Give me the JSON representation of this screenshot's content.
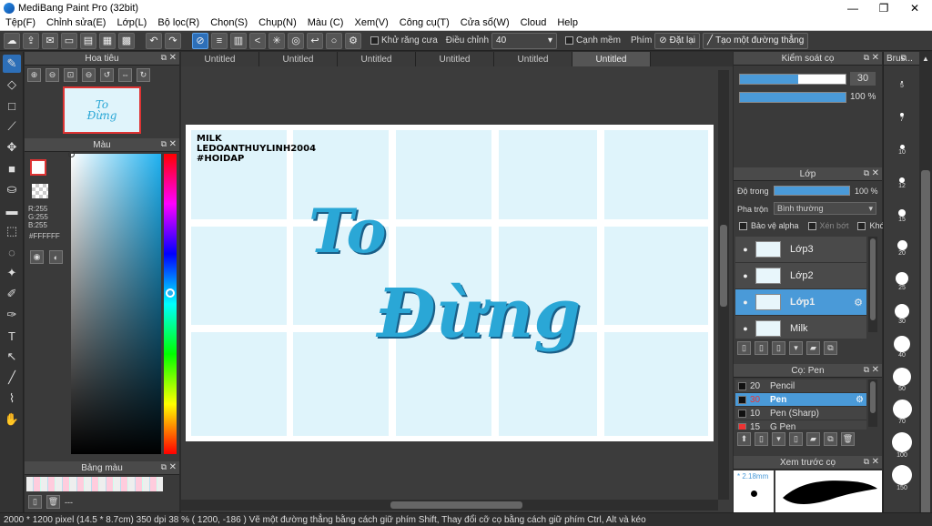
{
  "window": {
    "title": "MediBang Paint Pro (32bit)",
    "min": "—",
    "max": "❐",
    "close": "✕"
  },
  "menu": [
    "Tệp(F)",
    "Chỉnh sửa(E)",
    "Lớp(L)",
    "Bộ lọc(R)",
    "Chọn(S)",
    "Chụp(N)",
    "Màu (C)",
    "Xem(V)",
    "Công cụ(T)",
    "Cửa sổ(W)",
    "Cloud",
    "Help"
  ],
  "toolbar": {
    "antialias_label": "Khử răng cưa",
    "correction_label": "Điều chỉnh",
    "correction_value": "40",
    "edge_label": "Cạnh mềm",
    "key_label": "Phím",
    "reset_label": "Đặt lại",
    "straight_label": "Tạo một đường thẳng"
  },
  "tabs": [
    "Untitled",
    "Untitled",
    "Untitled",
    "Untitled",
    "Untitled",
    "Untitled"
  ],
  "navigator": {
    "title": "Hoa tiêu"
  },
  "color": {
    "title": "Màu",
    "rgb": [
      "R:255",
      "G:255",
      "B:255"
    ],
    "hex": "#FFFFFF"
  },
  "palette": {
    "title": "Bảng màu",
    "dash": "---"
  },
  "canvas_text": {
    "line1": "MILK",
    "line2": "LEDOANTHUYLINH2004",
    "line3": "#HOIDAP",
    "art1": "To",
    "art2": "Đừng"
  },
  "brush_control": {
    "title": "Kiểm soát cọ",
    "size": "30",
    "opacity": "100 %"
  },
  "layer": {
    "title": "Lớp",
    "opacity_label": "Độ trong",
    "opacity_value": "100 %",
    "blend_label": "Pha trộn",
    "blend_value": "Bình thường",
    "protect_alpha": "Bảo vệ alpha",
    "clip": "Xén bớt",
    "lock": "Khóa",
    "layers": [
      "Lớp3",
      "Lớp2",
      "Lớp1",
      "Milk"
    ]
  },
  "brush": {
    "title": "Cọ: Pen",
    "items": [
      {
        "size": "20",
        "name": "Pencil"
      },
      {
        "size": "30",
        "name": "Pen"
      },
      {
        "size": "10",
        "name": "Pen (Sharp)"
      },
      {
        "size": "15",
        "name": "G Pen"
      }
    ]
  },
  "preview": {
    "title": "Xem trước cọ",
    "size": "* 2.18mm"
  },
  "brush_sizes": {
    "title": "Brus...",
    "values": [
      "5",
      "7",
      "10",
      "12",
      "15",
      "20",
      "25",
      "30",
      "40",
      "50",
      "70",
      "100",
      "150"
    ]
  },
  "status": "2000 * 1200 pixel   (14.5 * 8.7cm)   350 dpi   38 %   ( 1200, -186 )   Vẽ một đường thẳng bằng cách giữ phím Shift, Thay đổi cỡ cọ bằng cách giữ phím Ctrl, Alt và kéo",
  "colors": {
    "accent": "#4a9ad8",
    "canvas_bg": "#e0f4fb",
    "art": "#2aa7d6"
  }
}
